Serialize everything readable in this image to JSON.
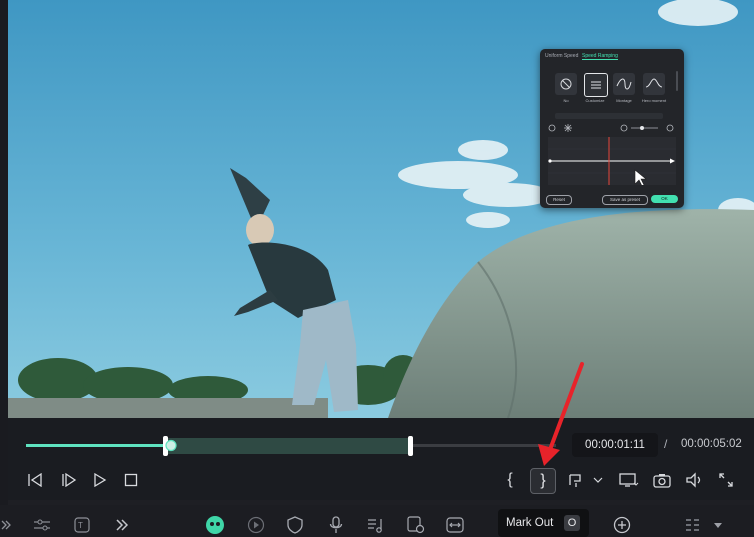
{
  "speed_panel": {
    "tabs": [
      {
        "label": "Uniform Speed",
        "active": false
      },
      {
        "label": "Speed Ramping",
        "active": true
      }
    ],
    "presets": [
      {
        "label": "No",
        "icon": "no-icon",
        "selected": false
      },
      {
        "label": "Customize",
        "icon": "customize-icon",
        "selected": true
      },
      {
        "label": "Montage",
        "icon": "wave-icon",
        "selected": false
      },
      {
        "label": "Hero moment",
        "icon": "hero-wave-icon",
        "selected": false
      }
    ],
    "buttons": {
      "reset": "Reset",
      "save": "Save as preset",
      "ok": "OK"
    },
    "accent": "#42e0b0"
  },
  "playback": {
    "current_time": "00:00:01:11",
    "separator": "/",
    "total_time": "00:00:05:02",
    "progress_color": "#5fe3c0"
  },
  "tooltip": {
    "label": "Mark Out",
    "shortcut": "O"
  },
  "annotation": {
    "arrow_color": "#e8232a"
  }
}
